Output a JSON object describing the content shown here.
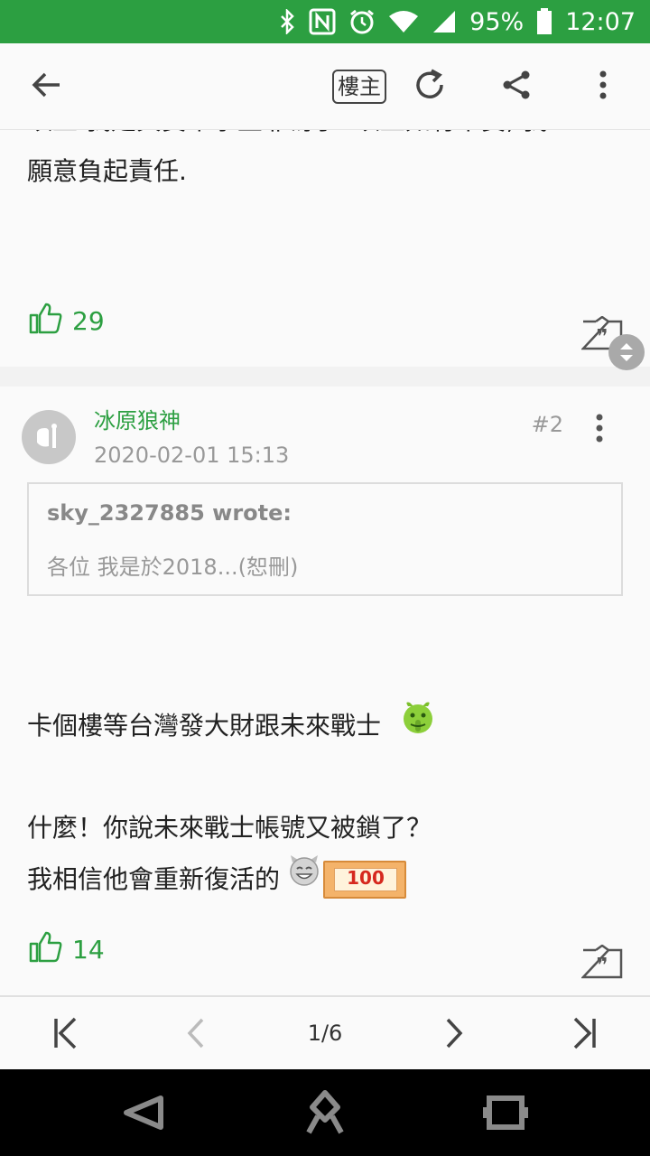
{
  "status_bar": {
    "battery": "95%",
    "time": "12:07",
    "icons": [
      "bluetooth-icon",
      "nfc-icon",
      "alarm-icon",
      "wifi-icon",
      "signal-icon",
      "battery-icon"
    ]
  },
  "app_bar": {
    "back_icon": "arrow-left-icon",
    "op_only_label": "樓主",
    "refresh_icon": "refresh-icon",
    "share_icon": "share-icon",
    "more_icon": "more-vertical-icon"
  },
  "posts": [
    {
      "text_lines": [
        "以上.我是真實單字並非寫手. 以上如有不實, 我",
        "願意負起責任."
      ],
      "likes": "29"
    },
    {
      "author": "冰原狼神",
      "date": "2020-02-01 15:13",
      "floor": "#2",
      "quote": {
        "author": "sky_2327885 wrote:",
        "body": "各位 我是於2018...(恕刪)"
      },
      "line1": "卡個樓等台灣發大財跟未來戰士",
      "line2": "什麼！你說未來戰士帳號又被鎖了？",
      "line3": "我相信他會重新復活的",
      "badge_text": "100",
      "likes": "14"
    }
  ],
  "pager": {
    "page": "1/6"
  },
  "colors": {
    "accent": "#2c9f41",
    "status_bar": "#2c9f41",
    "text": "#222222",
    "muted": "#999999"
  }
}
